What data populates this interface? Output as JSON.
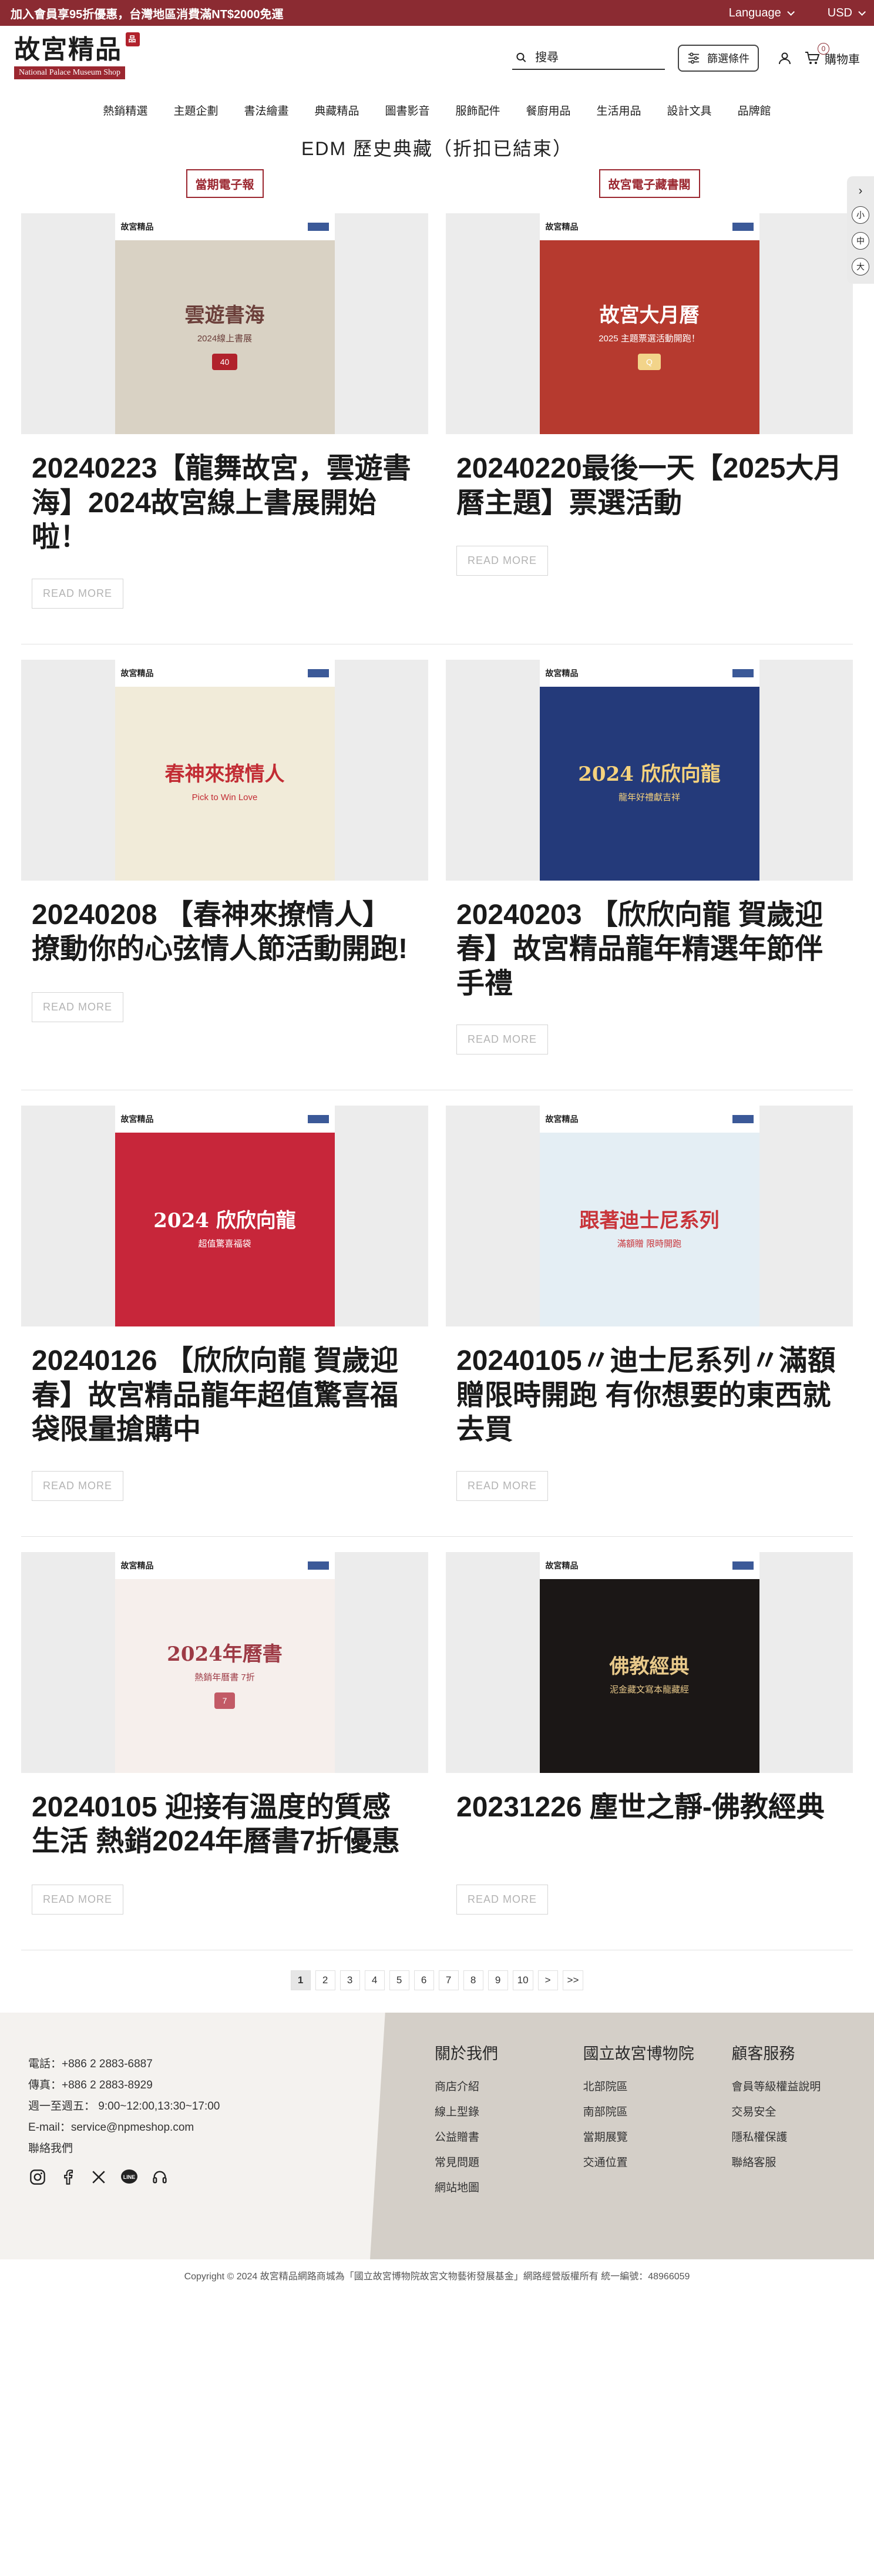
{
  "topbar": {
    "promo": "加入會員享95折優惠，台灣地區消費滿NT$2000免運",
    "language": "Language",
    "currency": "USD"
  },
  "header": {
    "logo_text": "故宮精品",
    "logo_seal": "品",
    "logo_subtitle": "National Palace Museum Shop",
    "search_placeholder": "搜尋",
    "filter_label": "篩選條件",
    "cart_label": "購物車",
    "cart_count": "0"
  },
  "nav": [
    "熱銷精選",
    "主題企劃",
    "書法繪畫",
    "典藏精品",
    "圖書影音",
    "服飾配件",
    "餐廚用品",
    "生活用品",
    "設計文具",
    "品牌館"
  ],
  "page": {
    "title": "EDM 歷史典藏（折扣已結束）",
    "tag_left": "當期電子報",
    "tag_right": "故宮電子藏書閣"
  },
  "read_more": "READ MORE",
  "cards": [
    {
      "title": "20240223【龍舞故宮，雲遊書海】2024故宮線上書展開始啦！",
      "poster": {
        "headline": "雲遊書海",
        "sub": "2024線上書展",
        "badge": "40",
        "bg": "#d9d2c4",
        "fg": "#6b3f3a",
        "accent": "#b1222c"
      }
    },
    {
      "title": "20240220最後一天【2025大月曆主題】票選活動",
      "poster": {
        "headline": "故宮大月曆",
        "sub": "2025 主題票選活動開跑！",
        "badge": "Q",
        "bg": "#b63a2f",
        "fg": "#ffffff",
        "accent": "#f2d48a"
      }
    },
    {
      "title": "20240208 【春神來撩情人】撩動你的心弦情人節活動開跑!",
      "poster": {
        "headline": "春神來撩情人",
        "sub": "Pick to Win Love",
        "badge": "",
        "bg": "#f1ebd9",
        "fg": "#c22c34",
        "accent": "#3e6b4a"
      }
    },
    {
      "title": "20240203 【欣欣向龍 賀歲迎春】故宮精品龍年精選年節伴手禮",
      "poster": {
        "headline": "2024 欣欣向龍",
        "sub": "龍年好禮獻吉祥",
        "badge": "",
        "bg": "#243a7a",
        "fg": "#f5d27d",
        "accent": "#c8343a"
      }
    },
    {
      "title": "20240126 【欣欣向龍 賀歲迎春】故宮精品龍年超值驚喜福袋限量搶購中",
      "poster": {
        "headline": "2024 欣欣向龍",
        "sub": "超值驚喜福袋",
        "badge": "",
        "bg": "#c7263a",
        "fg": "#ffffff",
        "accent": "#1f2f66"
      }
    },
    {
      "title": "20240105〃迪士尼系列〃滿額贈限時開跑 有你想要的東西就去買",
      "poster": {
        "headline": "跟著迪士尼系列",
        "sub": "滿額贈 限時開跑",
        "badge": "",
        "bg": "#e4eef4",
        "fg": "#c8343a",
        "accent": "#1f3b70"
      }
    },
    {
      "title": "20240105 迎接有溫度的質感生活 熱銷2024年曆書7折優惠",
      "poster": {
        "headline": "2024年曆書",
        "sub": "熱銷年曆書 7折",
        "badge": "7",
        "bg": "#f6efec",
        "fg": "#9d3a45",
        "accent": "#c25a66"
      }
    },
    {
      "title": "20231226 塵世之靜-佛教經典",
      "poster": {
        "headline": "佛教經典",
        "sub": "泥金藏文寫本龍藏經",
        "badge": "",
        "bg": "#1b1716",
        "fg": "#e8c98a",
        "accent": "#c8343a"
      }
    }
  ],
  "pagination": [
    "1",
    "2",
    "3",
    "4",
    "5",
    "6",
    "7",
    "8",
    "9",
    "10",
    ">",
    ">>"
  ],
  "footer": {
    "phone": "電話：+886 2 2883-6887",
    "fax": "傳真：+886 2 2883-8929",
    "hours": "週一至週五： 9:00~12:00,13:30~17:00",
    "email": "E-mail：service@npmeshop.com",
    "contact": "聯絡我們",
    "cols": [
      {
        "title": "關於我們",
        "items": [
          "商店介紹",
          "線上型錄",
          "公益贈書",
          "常見問題",
          "網站地圖"
        ]
      },
      {
        "title": "國立故宮博物院",
        "items": [
          "北部院區",
          "南部院區",
          "當期展覽",
          "交通位置"
        ]
      },
      {
        "title": "顧客服務",
        "items": [
          "會員等級權益說明",
          "交易安全",
          "隱私權保護",
          "聯絡客服"
        ]
      }
    ],
    "copyright": "Copyright © 2024 故宮精品網路商城為「國立故宮博物院故宮文物藝術發展基金」網路經營版權所有 統一編號：48966059"
  },
  "side_widget": {
    "font_small": "小",
    "font_mid": "中",
    "font_large": "大"
  }
}
